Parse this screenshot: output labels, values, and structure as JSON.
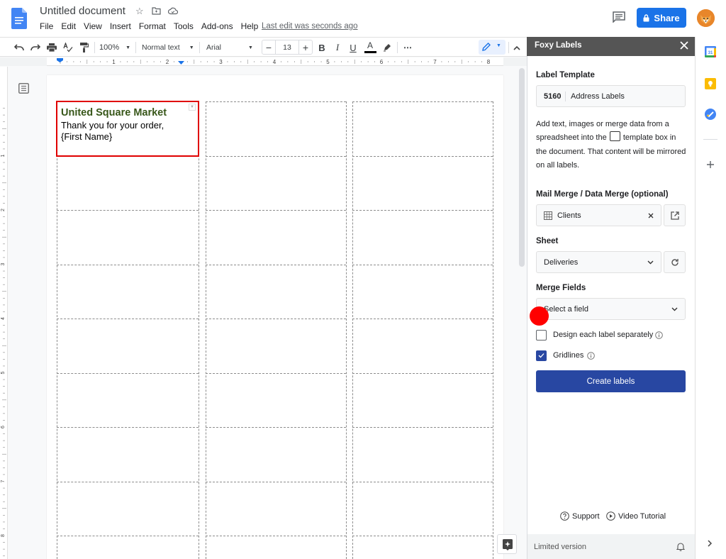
{
  "app": {
    "title": "Untitled document",
    "menu": [
      "File",
      "Edit",
      "View",
      "Insert",
      "Format",
      "Tools",
      "Add-ons",
      "Help"
    ],
    "last_edit": "Last edit was seconds ago",
    "share_label": "Share"
  },
  "toolbar": {
    "zoom": "100%",
    "style": "Normal text",
    "font": "Arial",
    "font_size": "13",
    "minus": "−",
    "plus": "+",
    "bold": "B",
    "italic": "I",
    "underline": "U",
    "text_color": "A",
    "more": "⋯"
  },
  "ruler": {
    "h_ticks": [
      "1",
      "2",
      "3",
      "4",
      "5",
      "6",
      "7",
      "8"
    ],
    "v_ticks": [
      "1",
      "2",
      "3",
      "4",
      "5",
      "6",
      "7",
      "8"
    ]
  },
  "document": {
    "template_label": {
      "title": "United Square Market",
      "line1": "Thank you for your order,",
      "line2": "{First Name}"
    },
    "grid": {
      "columns": 3,
      "rows_visible": 9
    }
  },
  "sidebar": {
    "title": "Foxy Labels",
    "label_template_heading": "Label Template",
    "template_code": "5160",
    "template_name": "Address Labels",
    "description_before": "Add text, images or merge data from a spreadsheet into the",
    "description_after": "template box in the document. That content will be mirrored on all labels.",
    "mail_merge_heading": "Mail Merge / Data Merge (optional)",
    "spreadsheet": "Clients",
    "sheet_heading": "Sheet",
    "sheet_value": "Deliveries",
    "merge_fields_heading": "Merge Fields",
    "merge_fields_placeholder": "Select a field",
    "design_separately_label": "Design each label separately",
    "design_separately_checked": false,
    "gridlines_label": "Gridlines",
    "gridlines_checked": true,
    "create_button": "Create labels",
    "support_link": "Support",
    "video_link": "Video Tutorial",
    "footer_text": "Limited version"
  },
  "colors": {
    "share_blue": "#1a73e8",
    "create_button": "#2847a2",
    "template_border": "#e00000",
    "title_green": "#38571a",
    "sidebar_header": "#555555"
  }
}
